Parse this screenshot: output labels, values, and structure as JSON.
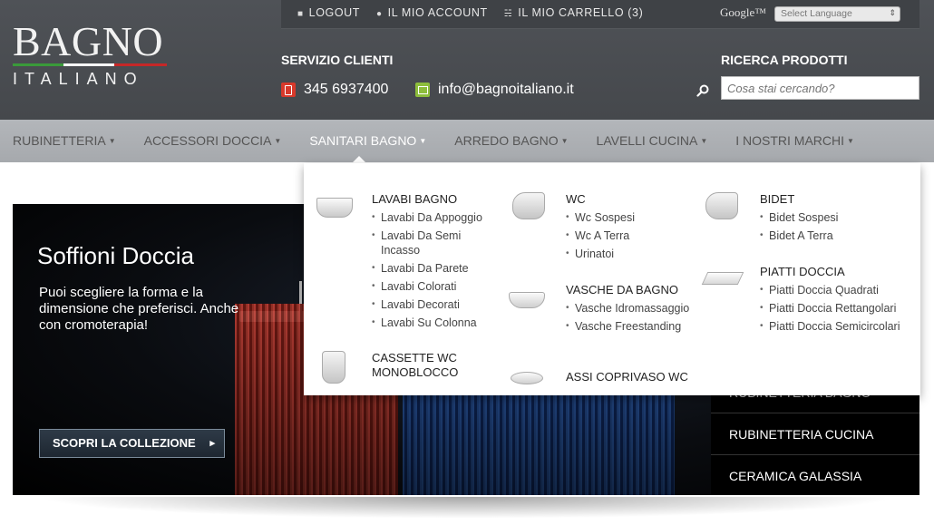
{
  "topbar": {
    "logout": "LOGOUT",
    "account": "IL MIO ACCOUNT",
    "cart": "IL MIO CARRELLO (3)",
    "google": "Google™",
    "language_select": "Select Language"
  },
  "logo": {
    "line1": "BAGNO",
    "line2": "ITALIANO"
  },
  "servizio": {
    "title": "SERVIZIO CLIENTI",
    "phone": "345 6937400",
    "email": "info@bagnoitaliano.it"
  },
  "ricerca": {
    "title": "RICERCA PRODOTTI",
    "placeholder": "Cosa stai cercando?"
  },
  "nav": [
    {
      "label": "RUBINETTERIA"
    },
    {
      "label": "ACCESSORI DOCCIA"
    },
    {
      "label": "SANITARI BAGNO"
    },
    {
      "label": "ARREDO BAGNO"
    },
    {
      "label": "LAVELLI CUCINA"
    },
    {
      "label": "I NOSTRI MARCHI"
    }
  ],
  "mega": {
    "lavabi": {
      "title": "LAVABI BAGNO",
      "items": [
        "Lavabi Da Appoggio",
        "Lavabi Da Semi Incasso",
        "Lavabi Da Parete",
        "Lavabi Colorati",
        "Lavabi Decorati",
        "Lavabi Su Colonna"
      ]
    },
    "cassette": {
      "title": "CASSETTE WC MONOBLOCCO"
    },
    "wc": {
      "title": "WC",
      "items": [
        "Wc Sospesi",
        "Wc A Terra",
        "Urinatoi"
      ]
    },
    "vasche": {
      "title": "VASCHE DA BAGNO",
      "items": [
        "Vasche Idromassaggio",
        "Vasche Freestanding"
      ]
    },
    "assi": {
      "title": "ASSI COPRIVASO WC"
    },
    "bidet": {
      "title": "BIDET",
      "items": [
        "Bidet Sospesi",
        "Bidet A Terra"
      ]
    },
    "piatti": {
      "title": "PIATTI DOCCIA",
      "items": [
        "Piatti Doccia Quadrati",
        "Piatti Doccia Rettangolari",
        "Piatti Doccia Semicircolari"
      ]
    }
  },
  "hero": {
    "title": "Soffioni Doccia",
    "text": "Puoi scegliere la forma e la dimensione che preferisci. Anche con cromoterapia!",
    "button": "SCOPRI LA COLLEZIONE",
    "side_items": [
      "RUBINETTERIA BAGNO",
      "RUBINETTERIA CUCINA",
      "CERAMICA GALASSIA"
    ]
  }
}
